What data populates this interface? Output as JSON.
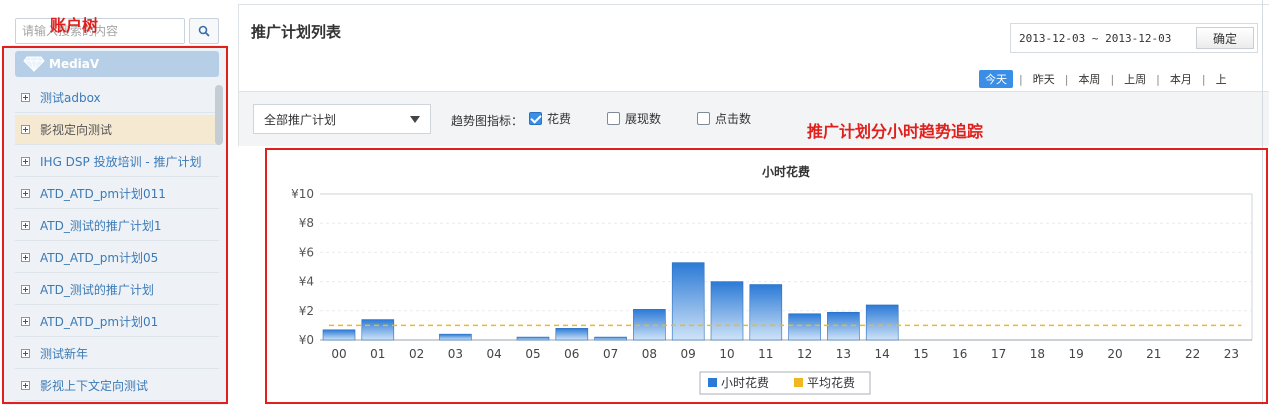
{
  "annotations": {
    "account_tree": "账户树",
    "hourly_trend": "推广计划分小时趋势追踪"
  },
  "sidebar": {
    "search_placeholder": "请输入搜索的内容",
    "root": "MediaV",
    "items": [
      {
        "label": "测试adbox"
      },
      {
        "label": "影视定向测试"
      },
      {
        "label": "IHG DSP 投放培训 - 推广计划"
      },
      {
        "label": "ATD_ATD_pm计划011"
      },
      {
        "label": "ATD_测试的推广计划1"
      },
      {
        "label": "ATD_ATD_pm计划05"
      },
      {
        "label": "ATD_测试的推广计划"
      },
      {
        "label": "ATD_ATD_pm计划01"
      },
      {
        "label": "测试新年"
      },
      {
        "label": "影视上下文定向测试"
      }
    ]
  },
  "header": {
    "title": "推广计划列表",
    "date_range": "2013-12-03 ~ 2013-12-03",
    "confirm": "确定",
    "periods": [
      "今天",
      "昨天",
      "本周",
      "上周",
      "本月",
      "上"
    ]
  },
  "filters": {
    "plan_select": "全部推广计划",
    "metric_label": "趋势图指标：",
    "metrics": [
      {
        "label": "花费",
        "checked": true
      },
      {
        "label": "展现数",
        "checked": false
      },
      {
        "label": "点击数",
        "checked": false
      }
    ]
  },
  "chart_data": {
    "type": "bar",
    "title": "小时花费",
    "categories": [
      "00",
      "01",
      "02",
      "03",
      "04",
      "05",
      "06",
      "07",
      "08",
      "09",
      "10",
      "11",
      "12",
      "13",
      "14",
      "15",
      "16",
      "17",
      "18",
      "19",
      "20",
      "21",
      "22",
      "23"
    ],
    "y_tick_labels": [
      "¥0",
      "¥2",
      "¥4",
      "¥6",
      "¥8",
      "¥10"
    ],
    "ylim": [
      0,
      10
    ],
    "series": [
      {
        "name": "小时花费",
        "type": "bar",
        "color": "#2b7ad6",
        "values": [
          0.7,
          1.4,
          0,
          0.4,
          0,
          0.2,
          0.8,
          0.2,
          2.1,
          5.3,
          4.0,
          3.8,
          1.8,
          1.9,
          2.4,
          0,
          0,
          0,
          0,
          0,
          0,
          0,
          0,
          0
        ]
      },
      {
        "name": "平均花费",
        "type": "line",
        "color": "#f0b820",
        "dashed": true,
        "value": 1.0
      }
    ],
    "legend": "bottom-center",
    "grid": true
  },
  "colors": {
    "accent": "#3a8ee6",
    "annotation_red": "#e0201c",
    "tree_link": "#3a7ab8"
  }
}
